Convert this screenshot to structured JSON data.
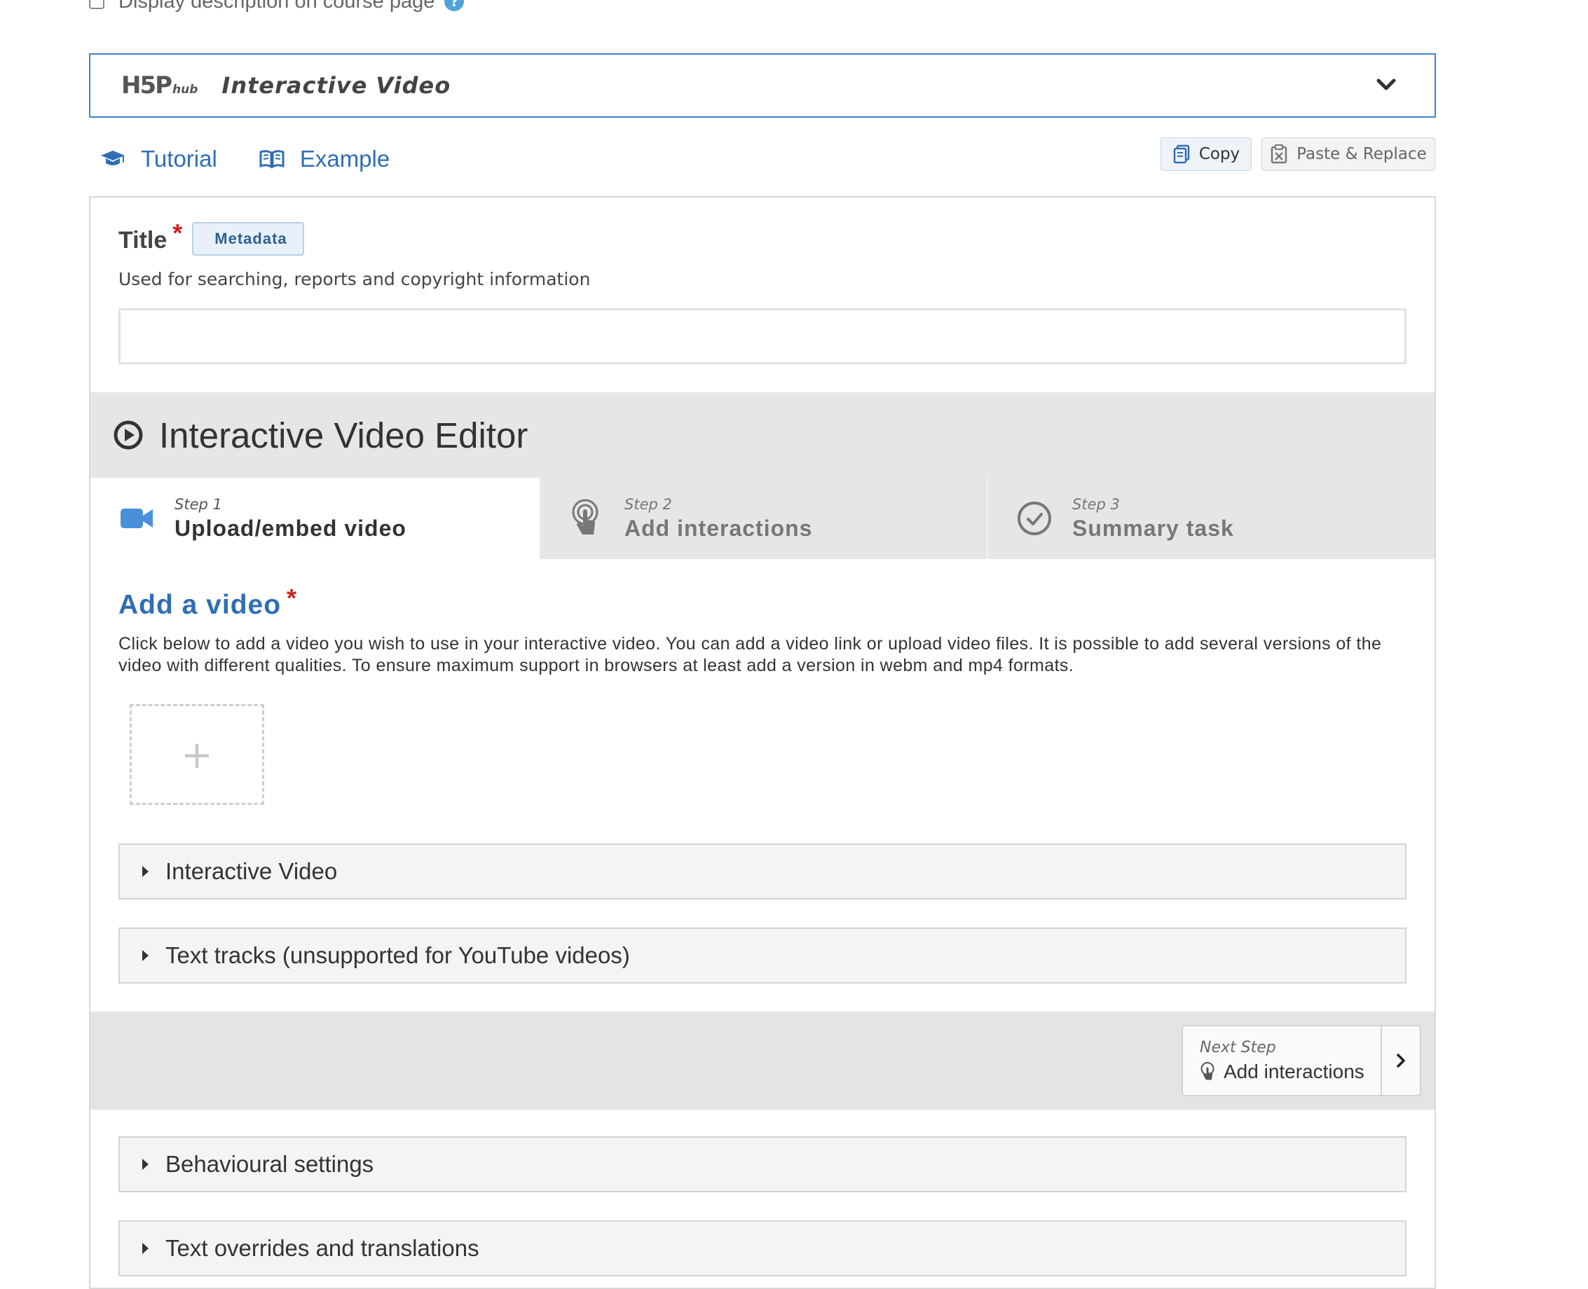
{
  "top_option": {
    "label": "Display description on course page",
    "help": "?"
  },
  "hub": {
    "logo_main": "H5P",
    "logo_sub": "hub",
    "title": "Interactive Video"
  },
  "links": {
    "tutorial": "Tutorial",
    "example": "Example"
  },
  "clipboard": {
    "copy": "Copy",
    "paste_replace": "Paste & Replace"
  },
  "title_field": {
    "label": "Title",
    "required_mark": "*",
    "metadata": "Metadata",
    "description": "Used for searching, reports and copyright information",
    "value": ""
  },
  "editor": {
    "title": "Interactive Video Editor",
    "steps": [
      {
        "small": "Step 1",
        "label": "Upload/embed video"
      },
      {
        "small": "Step 2",
        "label": "Add interactions"
      },
      {
        "small": "Step 3",
        "label": "Summary task"
      }
    ]
  },
  "add_video": {
    "title": "Add a video",
    "required_mark": "*",
    "description": "Click below to add a video you wish to use in your interactive video. You can add a video link or upload video files. It is possible to add several versions of the video with different qualities. To ensure maximum support in browsers at least add a version in webm and mp4 formats.",
    "add_symbol": "+"
  },
  "sections": [
    "Interactive Video",
    "Text tracks (unsupported for YouTube videos)",
    "Behavioural settings",
    "Text overrides and translations"
  ],
  "next_step": {
    "small": "Next Step",
    "label": "Add interactions"
  },
  "colors": {
    "accent": "#2f6eb5",
    "required": "#d21f1f",
    "hub_border": "#3b83cf",
    "step_active_icon": "#4a90d9"
  },
  "icons": {
    "help": "help-icon",
    "hub_toggle": "chevron-down-icon",
    "tutorial": "graduation-cap-icon",
    "example": "open-book-icon",
    "copy": "copy-icon",
    "paste": "paste-icon",
    "editor": "play-circle-icon",
    "step1": "video-camera-icon",
    "step2": "touch-pointer-icon",
    "step3": "check-circle-icon",
    "next": "chevron-right-icon"
  }
}
